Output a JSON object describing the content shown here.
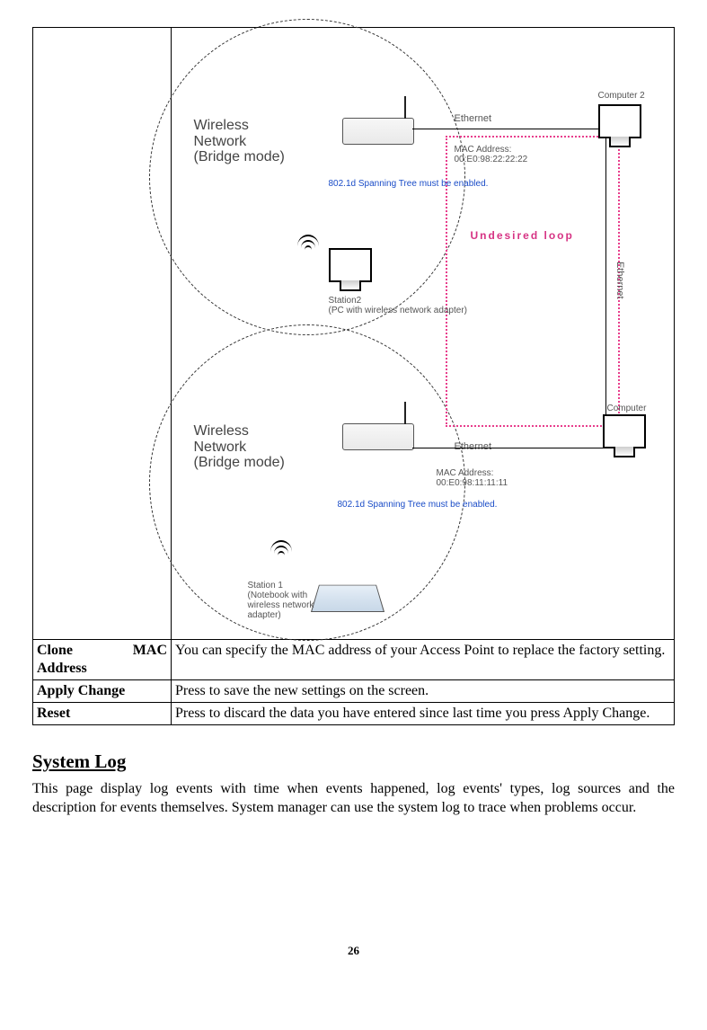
{
  "diagram": {
    "wireless_label_1_line1": "Wireless",
    "wireless_label_1_line2": "Network",
    "wireless_label_1_line3": "(Bridge mode)",
    "wireless_label_2_line1": "Wireless",
    "wireless_label_2_line2": "Network",
    "wireless_label_2_line3": "(Bridge mode)",
    "ethernet_1": "Ethernet",
    "ethernet_2": "Ethernet",
    "ethernet_3": "Ethernet",
    "computer2": "Computer 2",
    "computer1": "Computer",
    "mac1_line1": "MAC Address:",
    "mac1_line2": "00:E0:98:22:22:22",
    "mac2_line1": "MAC Address:",
    "mac2_line2": "00:E0:98:11:11:11",
    "spanning1": "802.1d Spanning Tree must be enabled.",
    "spanning2": "802.1d Spanning Tree must be enabled.",
    "undesired": "Undesired loop",
    "station2_line1": "Station2",
    "station2_line2": "(PC with wireless network adapter)",
    "station1_line1": "Station 1",
    "station1_line2": "(Notebook with",
    "station1_line3": "wireless network",
    "station1_line4": "adapter)"
  },
  "rows": {
    "clone_label": "Clone MAC Address",
    "clone_desc": "You can specify the MAC address of your Access Point to replace the factory setting.",
    "apply_label": "Apply Change",
    "apply_desc": "Press to save the new settings on the screen.",
    "reset_label": "Reset",
    "reset_desc": "Press to discard the data you have entered since last time you press Apply Change."
  },
  "section": {
    "heading": "System Log",
    "body": "This page display log events with time when events happened, log events' types, log sources and the description for events themselves. System manager can use the system log to trace when problems occur."
  },
  "page_number": "26"
}
